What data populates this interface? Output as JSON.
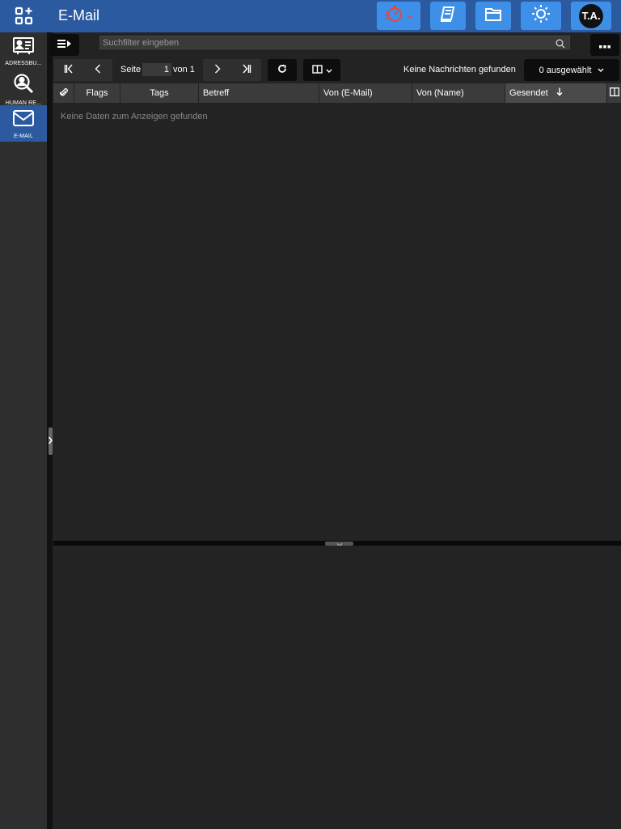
{
  "header": {
    "title": "E-Mail",
    "avatar_initials": "T.A."
  },
  "rail": {
    "items": [
      {
        "label": "ADRESSBU...",
        "icon": "address-book-icon"
      },
      {
        "label": "HUMAN RE...",
        "icon": "person-search-icon"
      },
      {
        "label": "E-MAIL",
        "icon": "envelope-icon",
        "active": true
      }
    ]
  },
  "toolbar": {
    "search_placeholder": "Suchfilter eingeben",
    "page_prefix": "Seite",
    "page_value": "1",
    "page_suffix": "von 1",
    "status": "Keine Nachrichten gefunden",
    "selected": "0 ausgewählt"
  },
  "grid": {
    "columns": [
      {
        "label": ""
      },
      {
        "label": "Flags"
      },
      {
        "label": "Tags"
      },
      {
        "label": "Betreff"
      },
      {
        "label": "Von (E-Mail)"
      },
      {
        "label": "Von (Name)"
      },
      {
        "label": "Gesendet",
        "sorted": "desc"
      }
    ],
    "empty_message": "Keine Daten zum Anzeigen gefunden"
  },
  "colors": {
    "topbar": "#2c5aa0",
    "button_accent": "#3d8fe8",
    "background": "#232323"
  }
}
